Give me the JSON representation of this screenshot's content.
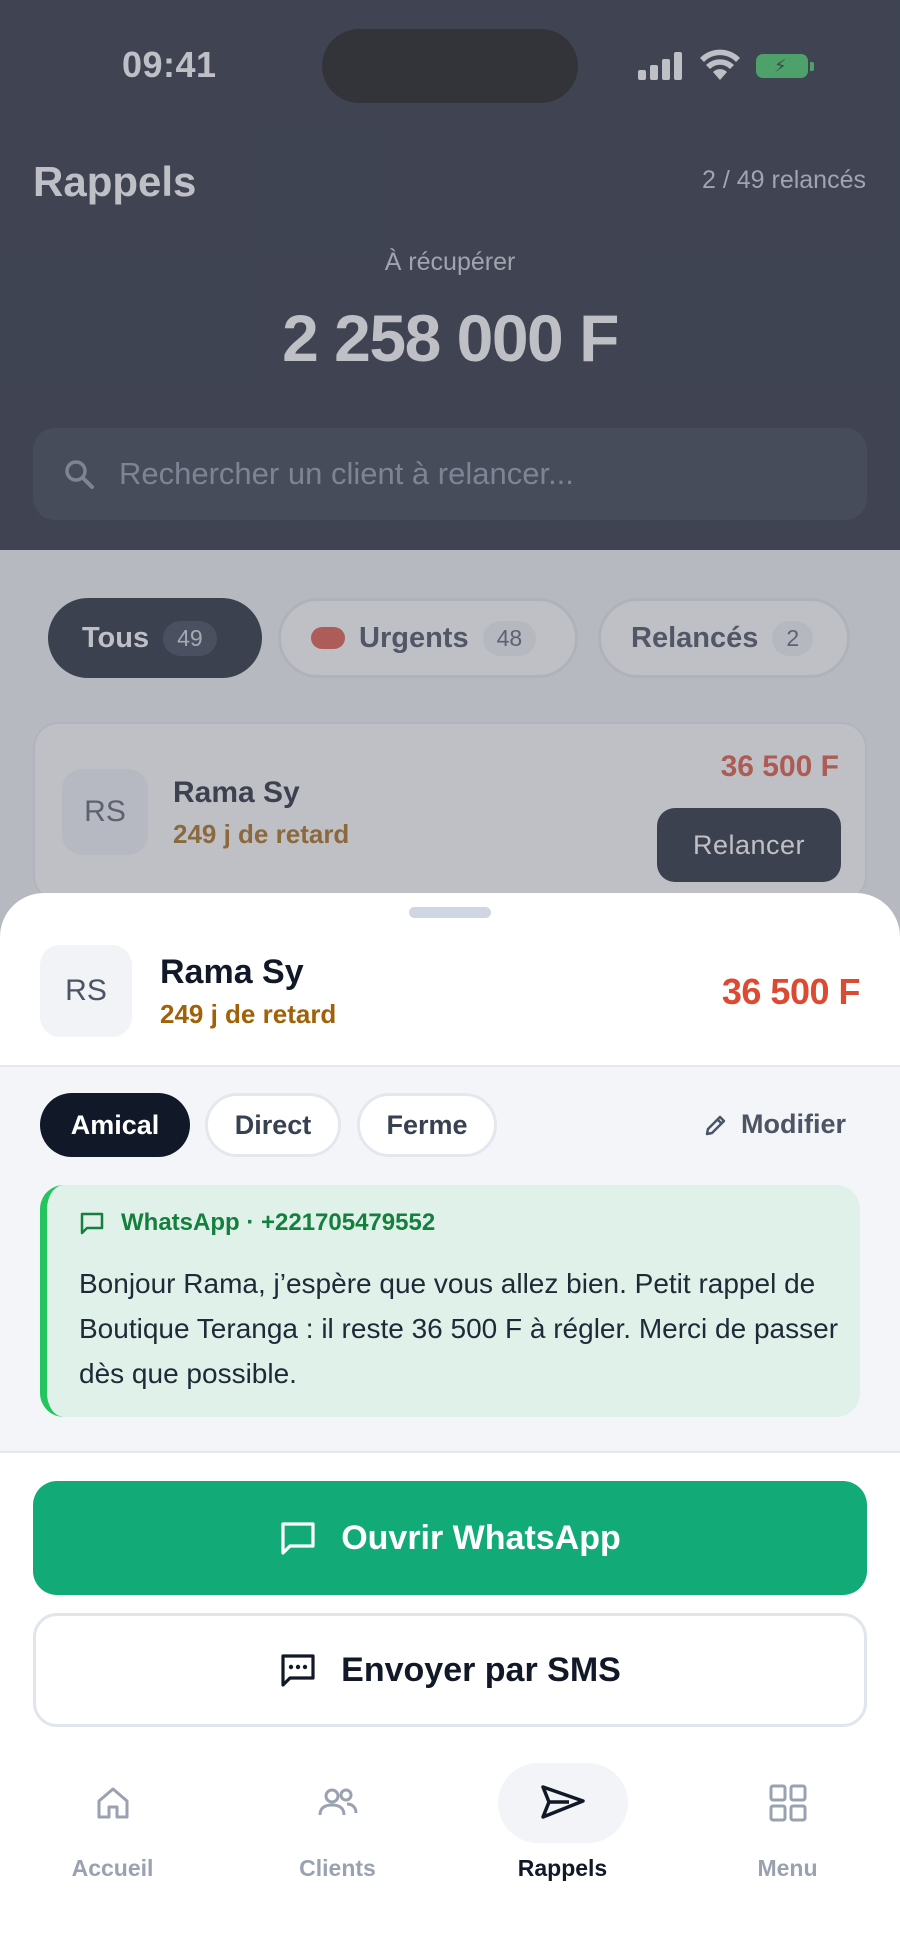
{
  "status_bar": {
    "time": "09:41"
  },
  "header": {
    "title": "Rappels",
    "progress_text": "2 / 49 relancés",
    "amount_label": "À récupérer",
    "amount": "2 258 000 F"
  },
  "search": {
    "placeholder": "Rechercher un client à relancer..."
  },
  "filters": [
    {
      "label": "Tous",
      "count": "49",
      "selected": true
    },
    {
      "label": "Urgents",
      "count": "48",
      "selected": false
    },
    {
      "label": "Relancés",
      "count": "2",
      "selected": false
    }
  ],
  "list": [
    {
      "initials": "RS",
      "name": "Rama Sy",
      "late": "249 j de retard",
      "amount": "36 500 F",
      "action": "Relancer"
    }
  ],
  "sheet": {
    "client": {
      "initials": "RS",
      "name": "Rama Sy",
      "late": "249 j de retard",
      "amount": "36 500 F"
    },
    "tones": [
      "Amical",
      "Direct",
      "Ferme"
    ],
    "selected_tone": "Amical",
    "edit_label": "Modifier",
    "message": {
      "channel": "WhatsApp · +221705479552",
      "text": "Bonjour Rama, j’espère que vous allez bien. Petit rappel de Boutique Teranga : il reste 36 500 F à régler. Merci de passer dès que possible."
    },
    "primary_action": "Ouvrir WhatsApp",
    "secondary_action": "Envoyer par SMS"
  },
  "nav": {
    "items": [
      {
        "label": "Accueil",
        "icon": "home-icon"
      },
      {
        "label": "Clients",
        "icon": "users-icon"
      },
      {
        "label": "Rappels",
        "icon": "send-icon",
        "active": true
      },
      {
        "label": "Menu",
        "icon": "grid-icon"
      }
    ]
  },
  "colors": {
    "header_bg": "#161c2c",
    "accent_green": "#12ab78",
    "amount_red": "#dc4a32",
    "late_amber": "#a16207"
  }
}
